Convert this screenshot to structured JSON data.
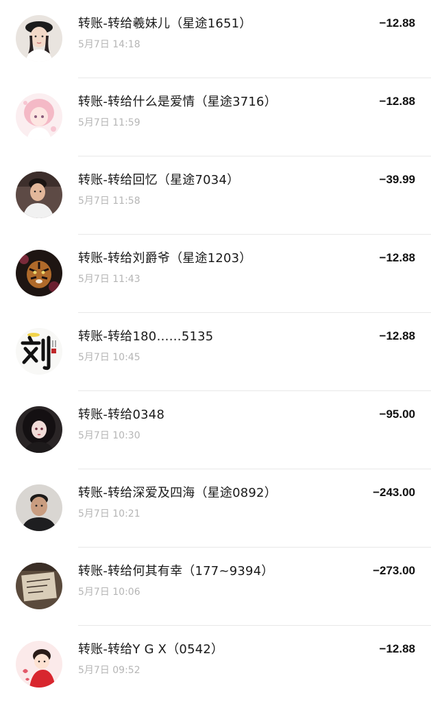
{
  "transactions": [
    {
      "title": "转账-转给羲妹儿（星途1651）",
      "time": "5月7日 14:18",
      "amount": "−12.88",
      "avatar_icon": "woman-beret-avatar-icon"
    },
    {
      "title": "转账-转给什么是爱情（星途3716）",
      "time": "5月7日 11:59",
      "amount": "−12.88",
      "avatar_icon": "anime-pink-girl-avatar-icon"
    },
    {
      "title": "转账-转给回忆（星途7034）",
      "time": "5月7日 11:58",
      "amount": "−39.99",
      "avatar_icon": "man-white-shirt-avatar-icon"
    },
    {
      "title": "转账-转给刘爵爷（星途1203）",
      "time": "5月7日 11:43",
      "amount": "−12.88",
      "avatar_icon": "tiger-avatar-icon"
    },
    {
      "title": "转账-转给180……5135",
      "time": "5月7日 10:45",
      "amount": "−12.88",
      "avatar_icon": "calligraphy-liu-avatar-icon"
    },
    {
      "title": "转账-转给0348",
      "time": "5月7日 10:30",
      "amount": "−95.00",
      "avatar_icon": "anime-dark-girl-avatar-icon"
    },
    {
      "title": "转账-转给深爱及四海（星途0892）",
      "time": "5月7日 10:21",
      "amount": "−243.00",
      "avatar_icon": "man-portrait-avatar-icon"
    },
    {
      "title": "转账-转给何其有幸（177~9394）",
      "time": "5月7日 10:06",
      "amount": "−273.00",
      "avatar_icon": "note-paper-avatar-icon"
    },
    {
      "title": "转账-转给Y G X（0542）",
      "time": "5月7日 09:52",
      "amount": "−12.88",
      "avatar_icon": "cartoon-kid-red-avatar-icon"
    }
  ]
}
